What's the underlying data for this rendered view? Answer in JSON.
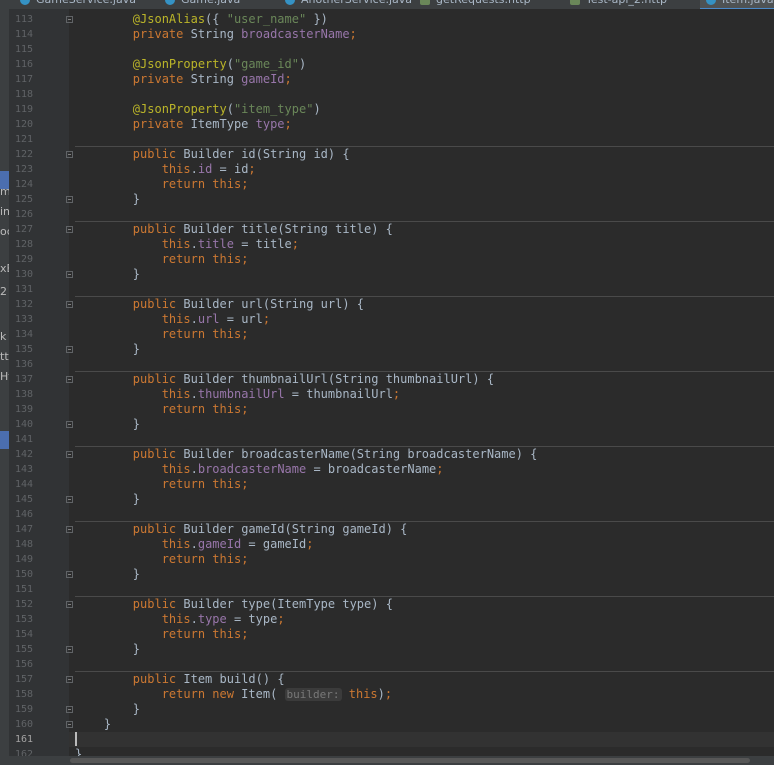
{
  "tabs": [
    {
      "label": "GameService.java",
      "icon": "java-class-icon"
    },
    {
      "label": "Game.java",
      "icon": "java-class-icon"
    },
    {
      "label": "AnotherService.java",
      "icon": "java-class-icon"
    },
    {
      "label": "getRequests.http",
      "icon": "api-icon"
    },
    {
      "label": "Test-api_2.http",
      "icon": "api-icon"
    },
    {
      "label": "Item.java",
      "icon": "java-class-icon"
    }
  ],
  "sidebar_fragments": [
    "m",
    "in",
    "oc",
    "xB",
    "2",
    "k",
    "tt",
    "Ht"
  ],
  "current_line": 161,
  "lines": [
    {
      "n": 113,
      "tokens": [
        [
          "        ",
          ""
        ],
        [
          "@JsonAlias",
          "ann"
        ],
        [
          "({ ",
          ""
        ],
        [
          "\"user_name\"",
          "str"
        ],
        [
          " })",
          ""
        ]
      ]
    },
    {
      "n": 114,
      "tokens": [
        [
          "        ",
          ""
        ],
        [
          "private",
          "kw"
        ],
        [
          " String ",
          ""
        ],
        [
          "broadcasterName",
          "fld"
        ],
        [
          ";",
          "kw"
        ]
      ]
    },
    {
      "n": 115,
      "tokens": []
    },
    {
      "n": 116,
      "tokens": [
        [
          "        ",
          ""
        ],
        [
          "@JsonProperty",
          "ann"
        ],
        [
          "(",
          ""
        ],
        [
          "\"game_id\"",
          "str"
        ],
        [
          ")",
          ""
        ]
      ]
    },
    {
      "n": 117,
      "tokens": [
        [
          "        ",
          ""
        ],
        [
          "private",
          "kw"
        ],
        [
          " String ",
          ""
        ],
        [
          "gameId",
          "fld"
        ],
        [
          ";",
          "kw"
        ]
      ]
    },
    {
      "n": 118,
      "tokens": []
    },
    {
      "n": 119,
      "tokens": [
        [
          "        ",
          ""
        ],
        [
          "@JsonProperty",
          "ann"
        ],
        [
          "(",
          ""
        ],
        [
          "\"item_type\"",
          "str"
        ],
        [
          ")",
          ""
        ]
      ]
    },
    {
      "n": 120,
      "tokens": [
        [
          "        ",
          ""
        ],
        [
          "private",
          "kw"
        ],
        [
          " ItemType ",
          ""
        ],
        [
          "type",
          "fld"
        ],
        [
          ";",
          "kw"
        ]
      ]
    },
    {
      "n": 121,
      "tokens": []
    },
    {
      "n": 122,
      "tokens": [
        [
          "        ",
          ""
        ],
        [
          "public",
          "kw"
        ],
        [
          " Builder ",
          ""
        ],
        [
          "id",
          "mth"
        ],
        [
          "(String id) {",
          ""
        ]
      ]
    },
    {
      "n": 123,
      "tokens": [
        [
          "            ",
          ""
        ],
        [
          "this",
          "kw"
        ],
        [
          ".",
          ""
        ],
        [
          "id",
          "fld"
        ],
        [
          " = id",
          ""
        ],
        [
          ";",
          "kw"
        ]
      ]
    },
    {
      "n": 124,
      "tokens": [
        [
          "            ",
          ""
        ],
        [
          "return this",
          "kw"
        ],
        [
          ";",
          "kw"
        ]
      ]
    },
    {
      "n": 125,
      "tokens": [
        [
          "        }",
          ""
        ]
      ]
    },
    {
      "n": 126,
      "tokens": []
    },
    {
      "n": 127,
      "tokens": [
        [
          "        ",
          ""
        ],
        [
          "public",
          "kw"
        ],
        [
          " Builder ",
          ""
        ],
        [
          "title",
          "mth"
        ],
        [
          "(String title) {",
          ""
        ]
      ]
    },
    {
      "n": 128,
      "tokens": [
        [
          "            ",
          ""
        ],
        [
          "this",
          "kw"
        ],
        [
          ".",
          ""
        ],
        [
          "title",
          "fld"
        ],
        [
          " = title",
          ""
        ],
        [
          ";",
          "kw"
        ]
      ]
    },
    {
      "n": 129,
      "tokens": [
        [
          "            ",
          ""
        ],
        [
          "return this",
          "kw"
        ],
        [
          ";",
          "kw"
        ]
      ]
    },
    {
      "n": 130,
      "tokens": [
        [
          "        }",
          ""
        ]
      ]
    },
    {
      "n": 131,
      "tokens": []
    },
    {
      "n": 132,
      "tokens": [
        [
          "        ",
          ""
        ],
        [
          "public",
          "kw"
        ],
        [
          " Builder ",
          ""
        ],
        [
          "url",
          "mth"
        ],
        [
          "(String url) {",
          ""
        ]
      ]
    },
    {
      "n": 133,
      "tokens": [
        [
          "            ",
          ""
        ],
        [
          "this",
          "kw"
        ],
        [
          ".",
          ""
        ],
        [
          "url",
          "fld"
        ],
        [
          " = url",
          ""
        ],
        [
          ";",
          "kw"
        ]
      ]
    },
    {
      "n": 134,
      "tokens": [
        [
          "            ",
          ""
        ],
        [
          "return this",
          "kw"
        ],
        [
          ";",
          "kw"
        ]
      ]
    },
    {
      "n": 135,
      "tokens": [
        [
          "        }",
          ""
        ]
      ]
    },
    {
      "n": 136,
      "tokens": []
    },
    {
      "n": 137,
      "tokens": [
        [
          "        ",
          ""
        ],
        [
          "public",
          "kw"
        ],
        [
          " Builder ",
          ""
        ],
        [
          "thumbnailUrl",
          "mth"
        ],
        [
          "(String thumbnailUrl) {",
          ""
        ]
      ]
    },
    {
      "n": 138,
      "tokens": [
        [
          "            ",
          ""
        ],
        [
          "this",
          "kw"
        ],
        [
          ".",
          ""
        ],
        [
          "thumbnailUrl",
          "fld"
        ],
        [
          " = thumbnailUrl",
          ""
        ],
        [
          ";",
          "kw"
        ]
      ]
    },
    {
      "n": 139,
      "tokens": [
        [
          "            ",
          ""
        ],
        [
          "return this",
          "kw"
        ],
        [
          ";",
          "kw"
        ]
      ]
    },
    {
      "n": 140,
      "tokens": [
        [
          "        }",
          ""
        ]
      ]
    },
    {
      "n": 141,
      "tokens": []
    },
    {
      "n": 142,
      "tokens": [
        [
          "        ",
          ""
        ],
        [
          "public",
          "kw"
        ],
        [
          " Builder ",
          ""
        ],
        [
          "broadcasterName",
          "mth"
        ],
        [
          "(String broadcasterName) {",
          ""
        ]
      ]
    },
    {
      "n": 143,
      "tokens": [
        [
          "            ",
          ""
        ],
        [
          "this",
          "kw"
        ],
        [
          ".",
          ""
        ],
        [
          "broadcasterName",
          "fld"
        ],
        [
          " = broadcasterName",
          ""
        ],
        [
          ";",
          "kw"
        ]
      ]
    },
    {
      "n": 144,
      "tokens": [
        [
          "            ",
          ""
        ],
        [
          "return this",
          "kw"
        ],
        [
          ";",
          "kw"
        ]
      ]
    },
    {
      "n": 145,
      "tokens": [
        [
          "        }",
          ""
        ]
      ]
    },
    {
      "n": 146,
      "tokens": []
    },
    {
      "n": 147,
      "tokens": [
        [
          "        ",
          ""
        ],
        [
          "public",
          "kw"
        ],
        [
          " Builder ",
          ""
        ],
        [
          "gameId",
          "mth"
        ],
        [
          "(String gameId) {",
          ""
        ]
      ]
    },
    {
      "n": 148,
      "tokens": [
        [
          "            ",
          ""
        ],
        [
          "this",
          "kw"
        ],
        [
          ".",
          ""
        ],
        [
          "gameId",
          "fld"
        ],
        [
          " = gameId",
          ""
        ],
        [
          ";",
          "kw"
        ]
      ]
    },
    {
      "n": 149,
      "tokens": [
        [
          "            ",
          ""
        ],
        [
          "return this",
          "kw"
        ],
        [
          ";",
          "kw"
        ]
      ]
    },
    {
      "n": 150,
      "tokens": [
        [
          "        }",
          ""
        ]
      ]
    },
    {
      "n": 151,
      "tokens": []
    },
    {
      "n": 152,
      "tokens": [
        [
          "        ",
          ""
        ],
        [
          "public",
          "kw"
        ],
        [
          " Builder ",
          ""
        ],
        [
          "type",
          "mth"
        ],
        [
          "(ItemType type) {",
          ""
        ]
      ]
    },
    {
      "n": 153,
      "tokens": [
        [
          "            ",
          ""
        ],
        [
          "this",
          "kw"
        ],
        [
          ".",
          ""
        ],
        [
          "type",
          "fld"
        ],
        [
          " = type",
          ""
        ],
        [
          ";",
          "kw"
        ]
      ]
    },
    {
      "n": 154,
      "tokens": [
        [
          "            ",
          ""
        ],
        [
          "return this",
          "kw"
        ],
        [
          ";",
          "kw"
        ]
      ]
    },
    {
      "n": 155,
      "tokens": [
        [
          "        }",
          ""
        ]
      ]
    },
    {
      "n": 156,
      "tokens": []
    },
    {
      "n": 157,
      "tokens": [
        [
          "        ",
          ""
        ],
        [
          "public",
          "kw"
        ],
        [
          " Item ",
          ""
        ],
        [
          "build",
          "mth"
        ],
        [
          "() {",
          ""
        ]
      ]
    },
    {
      "n": 158,
      "tokens": [
        [
          "            ",
          ""
        ],
        [
          "return new",
          "kw"
        ],
        [
          " Item( ",
          ""
        ],
        [
          "builder:",
          "hint"
        ],
        [
          " this",
          "kw"
        ],
        [
          ")",
          ""
        ],
        [
          ";",
          "kw"
        ]
      ]
    },
    {
      "n": 159,
      "tokens": [
        [
          "        }",
          ""
        ]
      ]
    },
    {
      "n": 160,
      "tokens": [
        [
          "    }",
          ""
        ]
      ]
    },
    {
      "n": 161,
      "tokens": []
    },
    {
      "n": 162,
      "tokens": [
        [
          "}",
          ""
        ]
      ]
    }
  ]
}
